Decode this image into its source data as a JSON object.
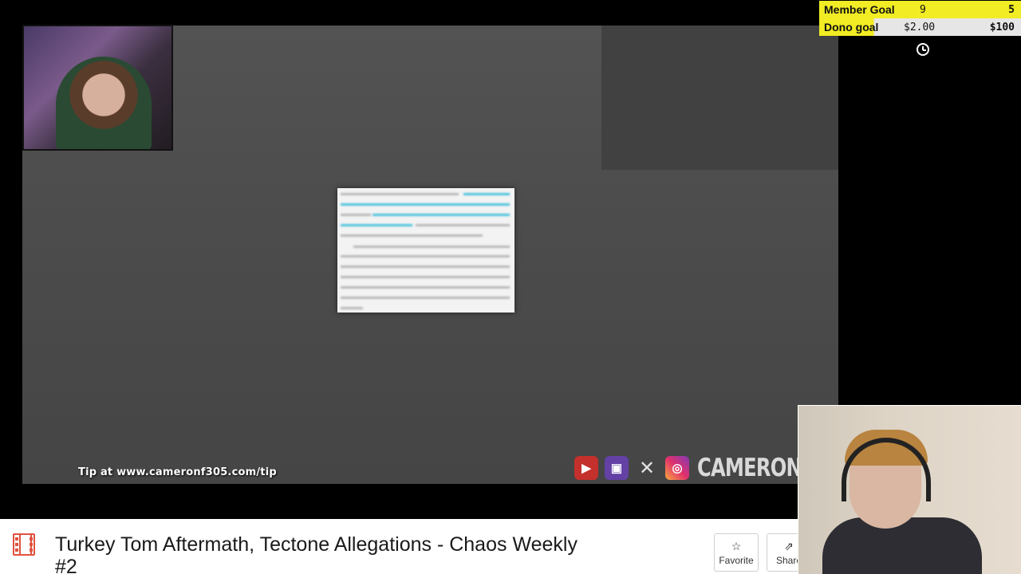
{
  "stream": {
    "tip_text": "Tip at www.cameronf305.com/tip",
    "brand_text": "CAMERONF",
    "social_icons": [
      "youtube-icon",
      "twitch-icon",
      "x-icon",
      "instagram-icon"
    ]
  },
  "goals": {
    "member": {
      "label": "Member Goal",
      "current": "9",
      "target": "5"
    },
    "dono": {
      "label": "Dono goal",
      "current": "$2.00",
      "target": "$100"
    }
  },
  "video": {
    "title": "Turkey Tom Aftermath, Tectone Allegations - Chaos Weekly #2",
    "favorite_label": "Favorite",
    "share_label": "Share"
  },
  "colors": {
    "goal_yellow": "#f1ec23",
    "youtube": "#c4302b",
    "twitch": "#6441a5",
    "film_icon": "#e0523e",
    "highlight": "#4fc3dc"
  }
}
